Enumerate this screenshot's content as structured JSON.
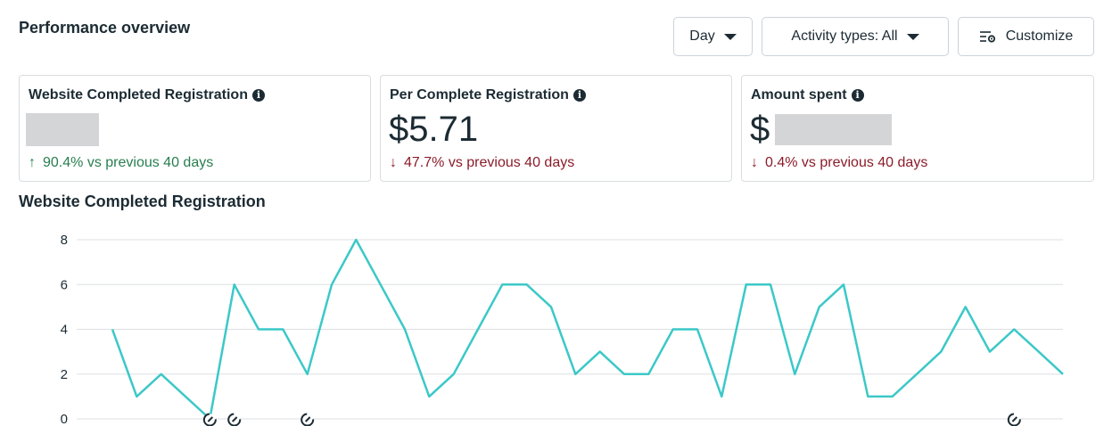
{
  "header": {
    "title": "Performance overview"
  },
  "toolbar": {
    "granularity_label": "Day",
    "activity_label": "Activity types: All",
    "customize_label": "Customize"
  },
  "cards": [
    {
      "title": "Website Completed Registration",
      "value": "",
      "delta": "90.4% vs previous 40 days",
      "direction": "up",
      "arrow": "↑"
    },
    {
      "title": "Per Complete Registration",
      "value": "$5.71",
      "delta": "47.7% vs previous 40 days",
      "direction": "down",
      "arrow": "↓"
    },
    {
      "title": "Amount spent",
      "value": "$",
      "delta": "0.4% vs previous 40 days",
      "direction": "down",
      "arrow": "↓"
    }
  ],
  "chart_title": "Website Completed Registration",
  "colors": {
    "line": "#3cc8c8",
    "grid": "#dcdfe3",
    "up": "#287e4f",
    "down": "#8a1c2a"
  },
  "chart_data": {
    "type": "line",
    "title": "Website Completed Registration",
    "xlabel": "",
    "ylabel": "",
    "ylim": [
      0,
      8
    ],
    "yticks": [
      "0",
      "2",
      "4",
      "6",
      "8"
    ],
    "grid": true,
    "series": [
      {
        "values": [
          4,
          1,
          2,
          1,
          0,
          6,
          4,
          4,
          2,
          6,
          8,
          6,
          4,
          1,
          2,
          4,
          6,
          6,
          5,
          2,
          3,
          2,
          2,
          4,
          4,
          1,
          6,
          6,
          2,
          5,
          6,
          1,
          1,
          2,
          3,
          5,
          3,
          4,
          3,
          2
        ]
      }
    ],
    "annotation_marker_indices": [
      4,
      5,
      8,
      37
    ]
  }
}
